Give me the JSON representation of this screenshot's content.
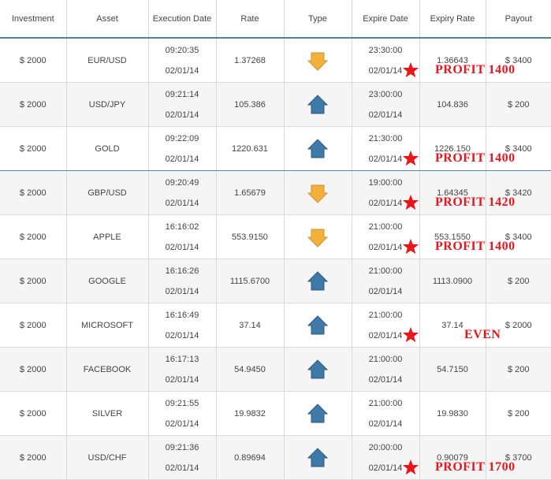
{
  "columns": [
    "Investment",
    "Asset",
    "Execution Date",
    "Rate",
    "Type",
    "Expire Date",
    "Expiry Rate",
    "Payout"
  ],
  "colors": {
    "down_arrow": "#f3b13b",
    "up_arrow": "#3f79a8",
    "annotation": "#e8161b",
    "header_rule": "#4f7fa8"
  },
  "rows": [
    {
      "investment": "$ 2000",
      "asset": "EUR/USD",
      "exec_time": "09:20:35",
      "exec_date": "02/01/14",
      "rate": "1.37268",
      "type": "down",
      "expire_time": "23:30:00",
      "expire_date": "02/01/14",
      "expiry_rate": "1.36643",
      "payout": "$ 3400",
      "annotation": "PROFIT 1400"
    },
    {
      "investment": "$ 2000",
      "asset": "USD/JPY",
      "exec_time": "09:21:14",
      "exec_date": "02/01/14",
      "rate": "105.386",
      "type": "up",
      "expire_time": "23:00:00",
      "expire_date": "02/01/14",
      "expiry_rate": "104.836",
      "payout": "$ 200",
      "annotation": ""
    },
    {
      "investment": "$ 2000",
      "asset": "GOLD",
      "exec_time": "09:22:09",
      "exec_date": "02/01/14",
      "rate": "1220.631",
      "type": "up",
      "expire_time": "21:30:00",
      "expire_date": "02/01/14",
      "expiry_rate": "1226.150",
      "payout": "$ 3400",
      "annotation": "PROFIT 1400"
    },
    {
      "investment": "$ 2000",
      "asset": "GBP/USD",
      "exec_time": "09:20:49",
      "exec_date": "02/01/14",
      "rate": "1.65679",
      "type": "down",
      "expire_time": "19:00:00",
      "expire_date": "02/01/14",
      "expiry_rate": "1.64345",
      "payout": "$ 3420",
      "annotation": "PROFIT 1420"
    },
    {
      "investment": "$ 2000",
      "asset": "APPLE",
      "exec_time": "16:16:02",
      "exec_date": "02/01/14",
      "rate": "553.9150",
      "type": "down",
      "expire_time": "21:00:00",
      "expire_date": "02/01/14",
      "expiry_rate": "553.1550",
      "payout": "$ 3400",
      "annotation": "PROFIT 1400"
    },
    {
      "investment": "$ 2000",
      "asset": "GOOGLE",
      "exec_time": "16:16:26",
      "exec_date": "02/01/14",
      "rate": "1115.6700",
      "type": "up",
      "expire_time": "21:00:00",
      "expire_date": "02/01/14",
      "expiry_rate": "1113.0900",
      "payout": "$ 200",
      "annotation": ""
    },
    {
      "investment": "$ 2000",
      "asset": "MICROSOFT",
      "exec_time": "16:16:49",
      "exec_date": "02/01/14",
      "rate": "37.14",
      "type": "up",
      "expire_time": "21:00:00",
      "expire_date": "02/01/14",
      "expiry_rate": "37.14",
      "payout": "$ 2000",
      "annotation": "EVEN"
    },
    {
      "investment": "$ 2000",
      "asset": "FACEBOOK",
      "exec_time": "16:17:13",
      "exec_date": "02/01/14",
      "rate": "54.9450",
      "type": "up",
      "expire_time": "21:00:00",
      "expire_date": "02/01/14",
      "expiry_rate": "54.7150",
      "payout": "$ 200",
      "annotation": ""
    },
    {
      "investment": "$ 2000",
      "asset": "SILVER",
      "exec_time": "09:21:55",
      "exec_date": "02/01/14",
      "rate": "19.9832",
      "type": "up",
      "expire_time": "21:00:00",
      "expire_date": "02/01/14",
      "expiry_rate": "19.9830",
      "payout": "$ 200",
      "annotation": ""
    },
    {
      "investment": "$ 2000",
      "asset": "USD/CHF",
      "exec_time": "09:21:36",
      "exec_date": "02/01/14",
      "rate": "0.89694",
      "type": "up",
      "expire_time": "20:00:00",
      "expire_date": "02/01/14",
      "expiry_rate": "0.90079",
      "payout": "$ 3700",
      "annotation": "PROFIT 1700"
    }
  ]
}
